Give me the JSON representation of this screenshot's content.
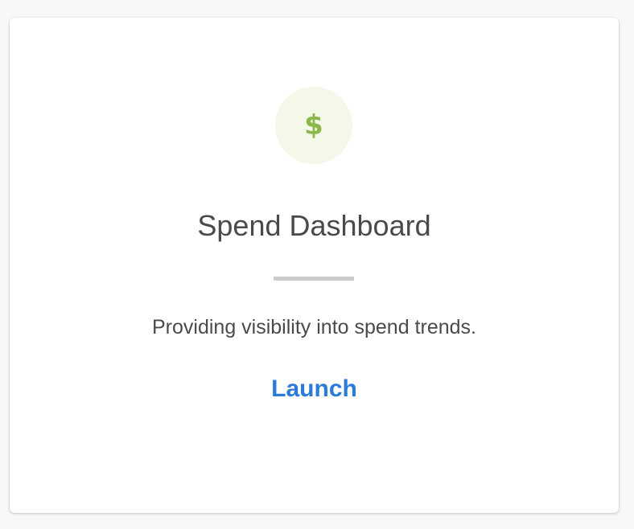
{
  "card": {
    "icon": {
      "name": "dollar-icon",
      "glyph": "$",
      "color": "#8cb84a",
      "background": "#f3f8e8"
    },
    "title": "Spend Dashboard",
    "description": "Providing visibility into spend trends.",
    "launch_label": "Launch"
  },
  "colors": {
    "accent": "#2b7bd9",
    "text": "#4a4a4a",
    "divider": "#cccccc"
  }
}
